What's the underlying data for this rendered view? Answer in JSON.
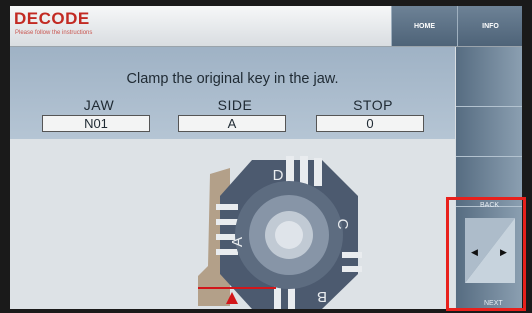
{
  "header": {
    "title": "DECODE",
    "subtitle": "Please follow the instructions",
    "home_label": "HOME",
    "info_label": "INFO"
  },
  "main": {
    "instruction": "Clamp the original key in the jaw.",
    "fields": [
      {
        "label": "JAW",
        "value": "N01"
      },
      {
        "label": "SIDE",
        "value": "A"
      },
      {
        "label": "STOP",
        "value": "0"
      }
    ]
  },
  "jaw": {
    "side_letters": [
      "A",
      "B",
      "C",
      "D"
    ]
  },
  "nav": {
    "back_label": "BACK",
    "next_label": "NEXT",
    "back_icon": "arrow-left-icon",
    "next_icon": "arrow-right-icon"
  },
  "colors": {
    "brand": "#c22a23",
    "highlight": "#e8201c",
    "marker": "#d2161a"
  }
}
